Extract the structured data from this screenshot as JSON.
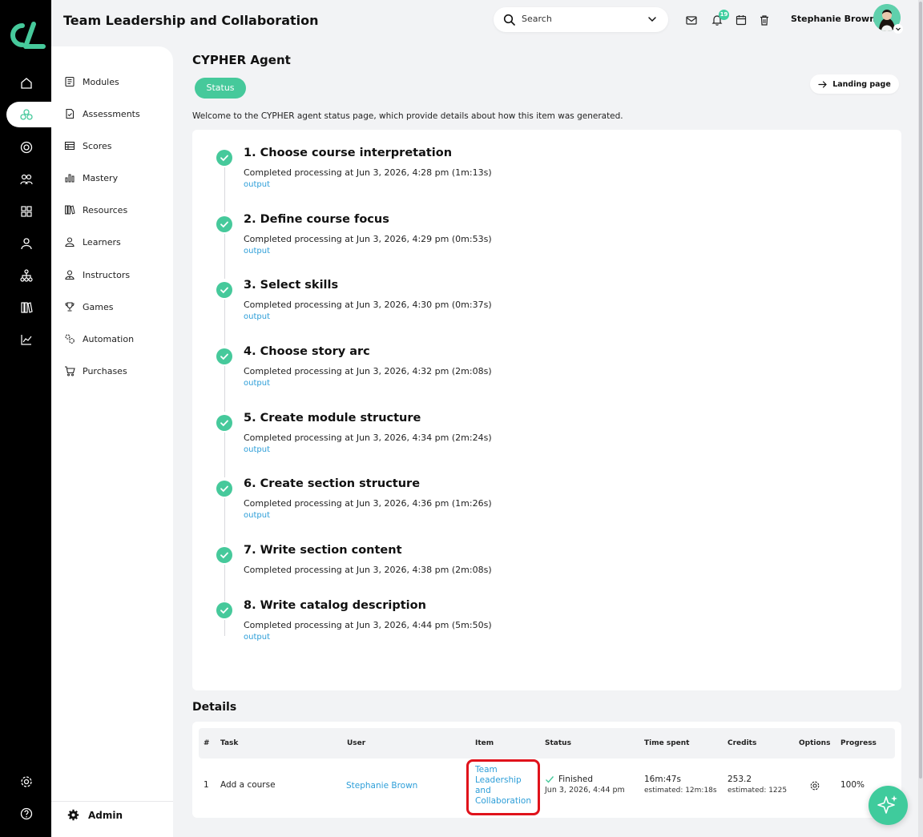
{
  "header": {
    "app_title": "Team Leadership and Collaboration",
    "search_label": "Search",
    "notification_count": "19",
    "user_name": "Stephanie Brown"
  },
  "sidebar": {
    "items": [
      {
        "label": "Modules",
        "icon": "modules-icon"
      },
      {
        "label": "Assessments",
        "icon": "assessments-icon"
      },
      {
        "label": "Scores",
        "icon": "scores-icon"
      },
      {
        "label": "Mastery",
        "icon": "mastery-icon"
      },
      {
        "label": "Resources",
        "icon": "resources-icon"
      },
      {
        "label": "Learners",
        "icon": "learners-icon"
      },
      {
        "label": "Instructors",
        "icon": "instructors-icon"
      },
      {
        "label": "Games",
        "icon": "games-icon"
      },
      {
        "label": "Automation",
        "icon": "automation-icon"
      },
      {
        "label": "Purchases",
        "icon": "purchases-icon"
      }
    ],
    "admin_label": "Admin"
  },
  "main": {
    "title": "CYPHER Agent",
    "status_tab": "Status",
    "landing_button": "Landing page",
    "welcome": "Welcome to the CYPHER agent status page, which provide details about how this item was generated.",
    "steps": [
      {
        "title": "1. Choose course interpretation",
        "desc": "Completed processing at Jun 3, 2026, 4:28 pm (1m:13s)",
        "output": "output"
      },
      {
        "title": "2. Define course focus",
        "desc": "Completed processing at Jun 3, 2026, 4:29 pm (0m:53s)",
        "output": "output"
      },
      {
        "title": "3. Select skills",
        "desc": "Completed processing at Jun 3, 2026, 4:30 pm (0m:37s)",
        "output": "output"
      },
      {
        "title": "4. Choose story arc",
        "desc": "Completed processing at Jun 3, 2026, 4:32 pm (2m:08s)",
        "output": "output"
      },
      {
        "title": "5. Create module structure",
        "desc": "Completed processing at Jun 3, 2026, 4:34 pm (2m:24s)",
        "output": "output"
      },
      {
        "title": "6. Create section structure",
        "desc": "Completed processing at Jun 3, 2026, 4:36 pm (1m:26s)",
        "output": "output"
      },
      {
        "title": "7. Write section content",
        "desc": "Completed processing at Jun 3, 2026, 4:38 pm (2m:08s)",
        "output": ""
      },
      {
        "title": "8. Write catalog description",
        "desc": "Completed processing at Jun 3, 2026, 4:44 pm (5m:50s)",
        "output": "output"
      }
    ]
  },
  "details": {
    "title": "Details",
    "columns": [
      "#",
      "Task",
      "User",
      "Item",
      "Status",
      "Time spent",
      "Credits",
      "Options",
      "Progress"
    ],
    "row": {
      "index": "1",
      "task": "Add a course",
      "user": "Stephanie Brown",
      "item": "Team Leadership and Collaboration",
      "status": "Finished",
      "status_date": "Jun 3, 2026, 4:44 pm",
      "time_spent": "16m:47s",
      "time_estimated": "estimated: 12m:18s",
      "credits": "253.2",
      "credits_estimated": "estimated: 1225",
      "progress": "100%"
    }
  },
  "colors": {
    "accent": "#46c99b",
    "link": "#2d9ed8",
    "highlight": "#e0121b",
    "rail": "#000000"
  }
}
